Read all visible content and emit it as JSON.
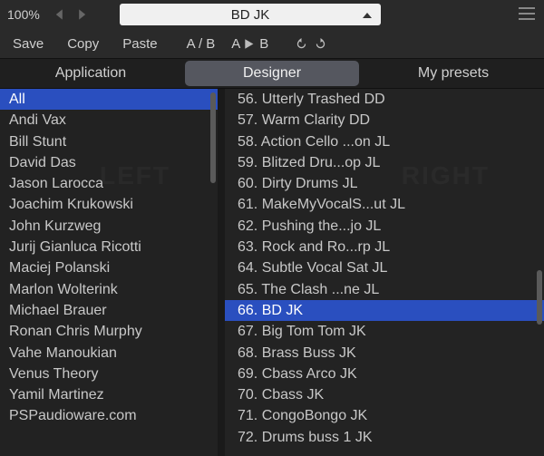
{
  "header": {
    "zoom": "100%",
    "preset_name": "BD JK"
  },
  "toolbar": {
    "save": "Save",
    "copy": "Copy",
    "paste": "Paste",
    "ab_compare": "A / B",
    "ab_copy": "A ▸ B"
  },
  "tabs": {
    "application": "Application",
    "designer": "Designer",
    "my_presets": "My presets"
  },
  "categories": [
    "All",
    "Andi Vax",
    "Bill Stunt",
    "David Das",
    "Jason Larocca",
    "Joachim Krukowski",
    "John Kurzweg",
    "Jurij Gianluca Ricotti",
    "Maciej Polanski",
    "Marlon Wolterink",
    "Michael Brauer",
    "Ronan Chris Murphy",
    "Vahe Manoukian",
    "Venus Theory",
    "Yamil Martinez",
    "PSPaudioware.com"
  ],
  "categories_selected_index": 0,
  "presets": [
    "56. Utterly Trashed DD",
    "57. Warm Clarity DD",
    "58. Action Cello ...on JL",
    "59. Blitzed Dru...op JL",
    "60. Dirty Drums JL",
    "61. MakeMyVocalS...ut JL",
    "62. Pushing the...jo JL",
    "63. Rock and Ro...rp JL",
    "64. Subtle Vocal Sat JL",
    "65. The Clash ...ne JL",
    "66. BD JK",
    "67. Big Tom Tom JK",
    "68. Brass Buss JK",
    "69. Cbass Arco JK",
    "70. Cbass JK",
    "71. CongoBongo JK",
    "72. Drums buss 1 JK"
  ],
  "presets_selected_index": 10,
  "backdrop": {
    "left": "LEFT",
    "right": "RIGHT"
  }
}
